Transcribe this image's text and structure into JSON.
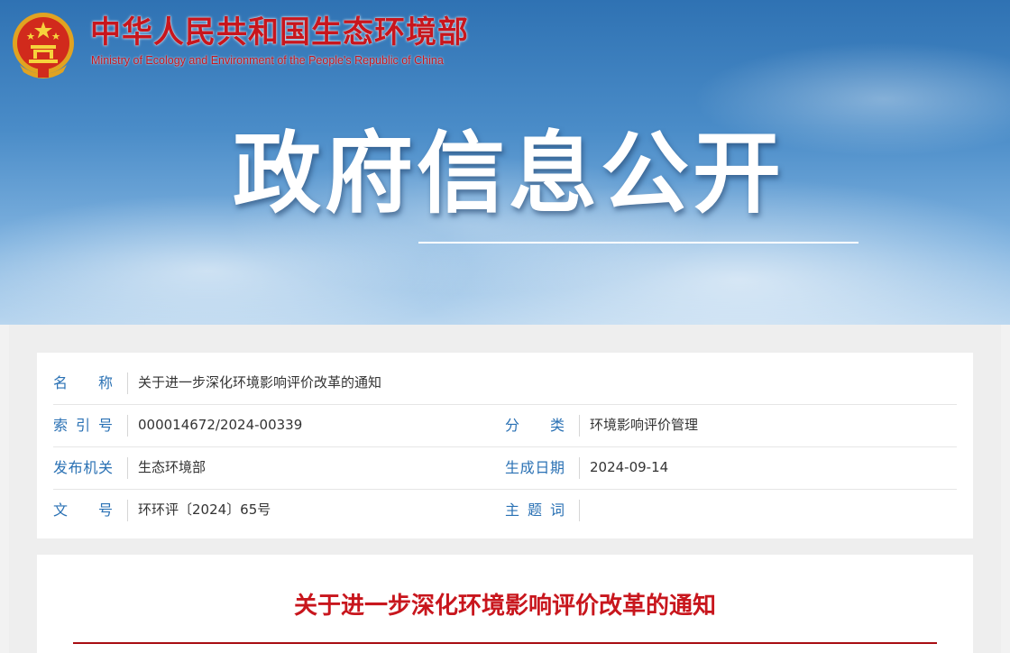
{
  "header": {
    "ministry_cn": "中华人民共和国生态环境部",
    "ministry_en": "Ministry of Ecology and Environment of the People's Republic of China",
    "banner_title": "政府信息公开"
  },
  "meta": {
    "name_label": "名称",
    "name_value": "关于进一步深化环境影响评价改革的通知",
    "index_label": "索引号",
    "index_value": "000014672/2024-00339",
    "category_label": "分类",
    "category_value": "环境影响评价管理",
    "publisher_label": "发布机关",
    "publisher_value": "生态环境部",
    "date_label": "生成日期",
    "date_value": "2024-09-14",
    "docno_label": "文号",
    "docno_value": "环环评〔2024〕65号",
    "keywords_label": "主题词",
    "keywords_value": ""
  },
  "article": {
    "title": "关于进一步深化环境影响评价改革的通知"
  },
  "colors": {
    "brand_red": "#c8161d",
    "label_blue": "#2a71b4"
  }
}
